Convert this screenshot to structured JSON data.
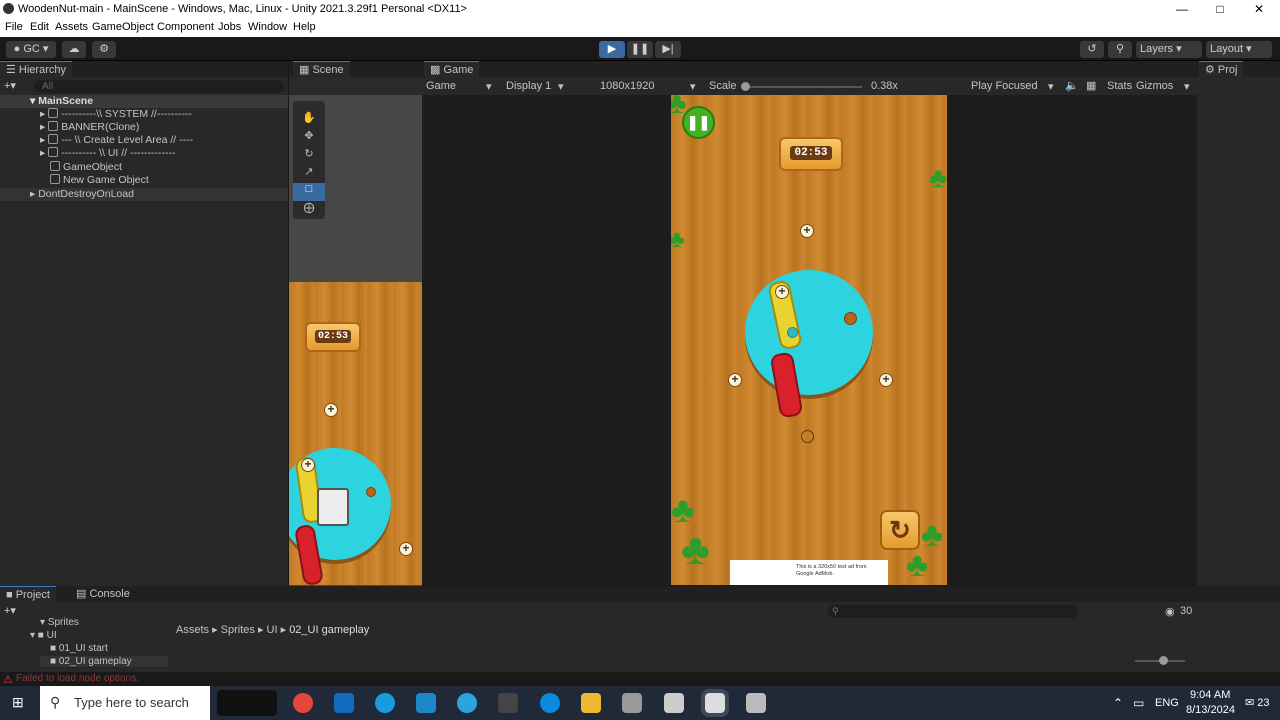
{
  "window": {
    "title": "WoodenNut-main - MainScene - Windows, Mac, Linux - Unity 2021.3.29f1 Personal <DX11>"
  },
  "menu": [
    "File",
    "Edit",
    "Assets",
    "GameObject",
    "Component",
    "Jobs",
    "Window",
    "Help"
  ],
  "toolbar": {
    "account": "GC",
    "layers": "Layers",
    "layout": "Layout"
  },
  "hierarchy": {
    "tab": "Hierarchy",
    "search_placeholder": "All",
    "items": [
      "MainScene",
      "----------\\\\ SYSTEM //----------",
      "BANNER(Clone)",
      "--- \\\\ Create Level Area // ----",
      "---------- \\\\ UI // -------------",
      "GameObject",
      "New Game Object",
      "DontDestroyOnLoad"
    ]
  },
  "scene": {
    "tab": "Scene",
    "timer": "02:53"
  },
  "game": {
    "tab": "Game",
    "mode": "Game",
    "display": "Display 1",
    "resolution": "1080x1920",
    "scale_label": "Scale",
    "scale_value": "0.38x",
    "play_mode": "Play Focused",
    "stats": "Stats",
    "gizmos": "Gizmos",
    "timer": "02:53",
    "ad_text": "This is a 320x50 test ad from Google AdMob."
  },
  "project_tab": "Proj",
  "bottom": {
    "tabs": [
      "Project",
      "Console"
    ],
    "tree": [
      "Sprites",
      "UI",
      "01_UI start",
      "02_UI gameplay"
    ],
    "breadcrumb": [
      "Assets",
      "Sprites",
      "UI",
      "02_UI gameplay"
    ],
    "count": "30"
  },
  "status": {
    "message": "Failed to load node options."
  },
  "taskbar": {
    "search": "Type here to search",
    "lang": "ENG",
    "time": "9:04 AM",
    "date": "8/13/2024",
    "notif": "23"
  }
}
